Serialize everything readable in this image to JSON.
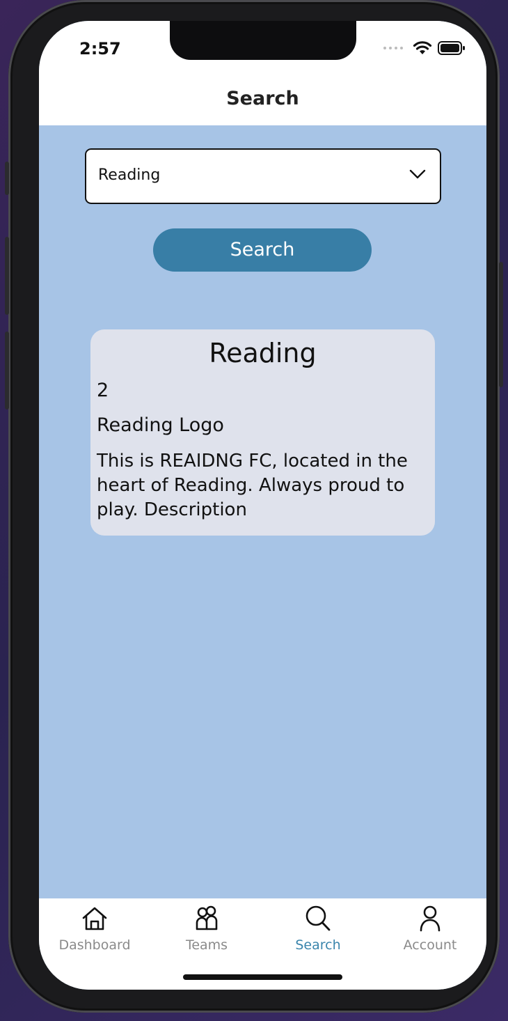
{
  "status_bar": {
    "time": "2:57"
  },
  "header": {
    "title": "Search"
  },
  "search": {
    "selected_value": "Reading",
    "button_label": "Search"
  },
  "result": {
    "title": "Reading",
    "number": "2",
    "logo_text": "Reading Logo",
    "description": "This is REAIDNG FC, located in the heart of Reading. Always proud to play.  Description"
  },
  "tabs": [
    {
      "label": "Dashboard",
      "icon": "home-icon",
      "active": false
    },
    {
      "label": "Teams",
      "icon": "teams-icon",
      "active": false
    },
    {
      "label": "Search",
      "icon": "search-icon",
      "active": true
    },
    {
      "label": "Account",
      "icon": "account-icon",
      "active": false
    }
  ],
  "colors": {
    "background": "#a7c4e6",
    "accent": "#387ea6",
    "card": "#dfe2ec",
    "active_tab": "#3a85ac"
  }
}
